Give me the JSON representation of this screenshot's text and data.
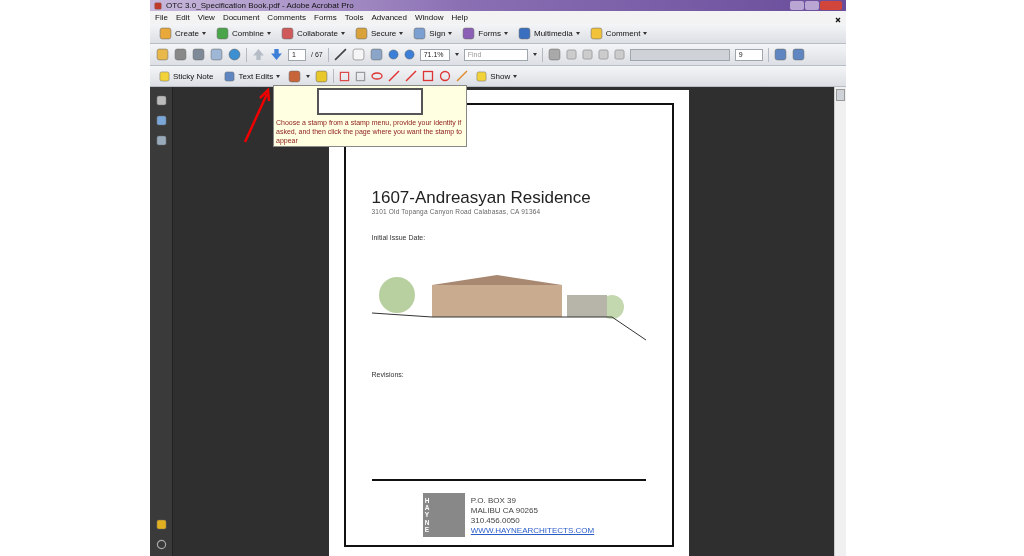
{
  "window": {
    "title": "OTC 3.0_Specification Book.pdf - Adobe Acrobat Pro"
  },
  "menu": [
    "File",
    "Edit",
    "View",
    "Document",
    "Comments",
    "Forms",
    "Tools",
    "Advanced",
    "Window",
    "Help"
  ],
  "task_toolbar": [
    {
      "label": "Create"
    },
    {
      "label": "Combine"
    },
    {
      "label": "Collaborate"
    },
    {
      "label": "Secure"
    },
    {
      "label": "Sign"
    },
    {
      "label": "Forms"
    },
    {
      "label": "Multimedia"
    },
    {
      "label": "Comment"
    }
  ],
  "nav_toolbar": {
    "page": "1",
    "page_count": "/ 67",
    "zoom": "71.1%",
    "find_placeholder": "Find",
    "font_size": "9"
  },
  "comment_toolbar": {
    "sticky_note": "Sticky Note",
    "text_edits": "Text Edits",
    "show": "Show"
  },
  "tooltip": {
    "text": "Choose a stamp from a stamp menu, provide your identity if asked, and then click the page where you want the stamp to appear"
  },
  "document": {
    "title": "1607-Andreasyan Residence",
    "address": "3101 Old Topanga Canyon Road Calabasas, CA 91364",
    "issue_label": "Initial Issue Date:",
    "revisions_label": "Revisions:",
    "logo_letters": "HAYNE",
    "footer_lines": [
      "P.O. BOX 39",
      "MALIBU CA 90265",
      "310.456.0050"
    ],
    "footer_link": "WWW.HAYNEARCHITECTS.COM"
  }
}
